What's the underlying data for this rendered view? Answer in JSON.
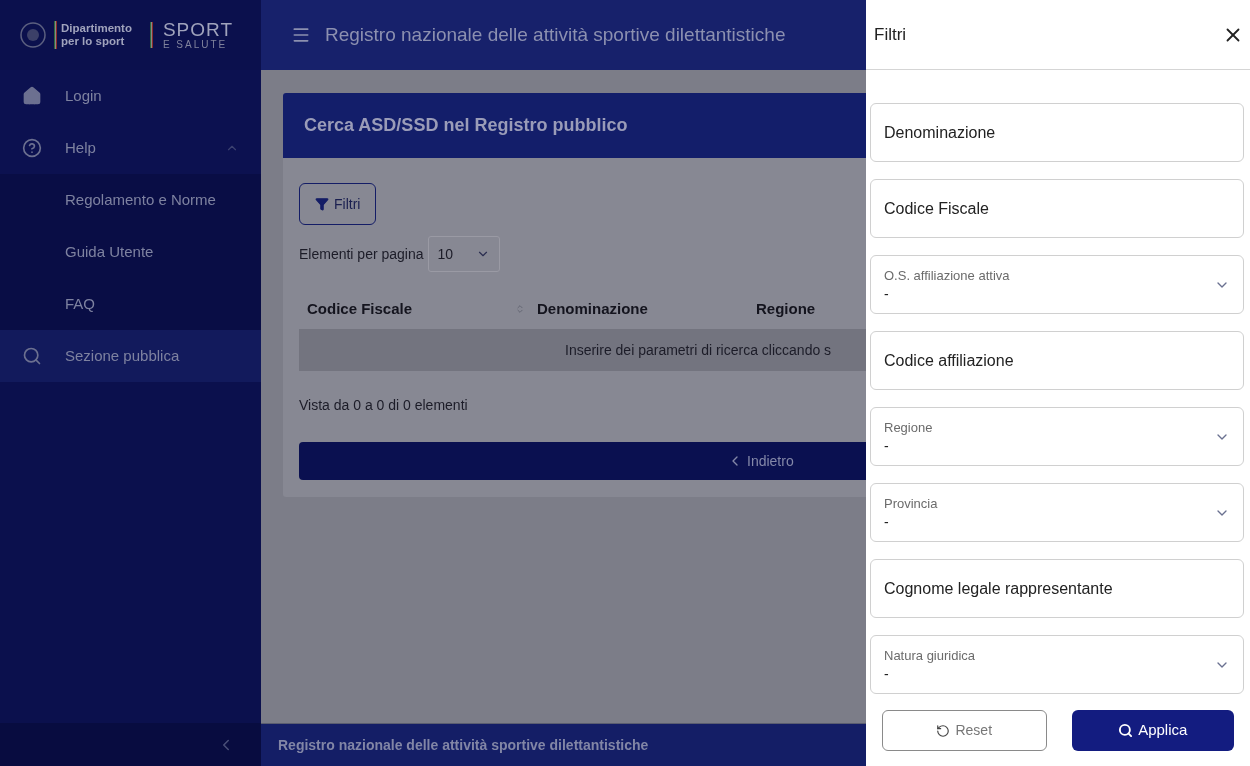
{
  "sidebar": {
    "logo": {
      "dept_line1": "Dipartimento",
      "dept_line2": "per lo sport",
      "brand": "SPORT",
      "brand_sub": "E SALUTE"
    },
    "items": [
      {
        "label": "Login",
        "kind": "home",
        "selected": false
      },
      {
        "label": "Help",
        "kind": "help",
        "selected": false,
        "expanded": true,
        "children": [
          {
            "label": "Regolamento e Norme"
          },
          {
            "label": "Guida Utente"
          },
          {
            "label": "FAQ"
          }
        ]
      },
      {
        "label": "Sezione pubblica",
        "kind": "search",
        "selected": true
      }
    ]
  },
  "topbar": {
    "title": "Registro nazionale delle attività sportive dilettantistiche"
  },
  "card": {
    "title": "Cerca ASD/SSD nel Registro pubblico",
    "filter_button": "Filtri",
    "page_size_label": "Elementi per pagina",
    "page_size": "10",
    "columns": [
      {
        "label": "Codice Fiscale",
        "sortable": true
      },
      {
        "label": "Denominazione",
        "sortable": false
      },
      {
        "label": "Regione",
        "sortable": false
      }
    ],
    "empty_message": "Inserire dei parametri di ricerca cliccando s",
    "summary": "Vista da 0 a 0 di 0 elementi",
    "back_button": "Indietro"
  },
  "footer": {
    "text": "Registro nazionale delle attività sportive dilettantistiche"
  },
  "drawer": {
    "title": "Filtri",
    "fields": [
      {
        "kind": "text",
        "placeholder": "Denominazione"
      },
      {
        "kind": "text",
        "placeholder": "Codice Fiscale"
      },
      {
        "kind": "select",
        "label": "O.S. affiliazione attiva",
        "value": "-"
      },
      {
        "kind": "text",
        "placeholder": "Codice affiliazione"
      },
      {
        "kind": "select",
        "label": "Regione",
        "value": "-"
      },
      {
        "kind": "select",
        "label": "Provincia",
        "value": "-"
      },
      {
        "kind": "text",
        "placeholder": "Cognome legale rappresentante"
      },
      {
        "kind": "select",
        "label": "Natura giuridica",
        "value": "-"
      }
    ],
    "reset_button": "Reset",
    "apply_button": "Applica"
  }
}
